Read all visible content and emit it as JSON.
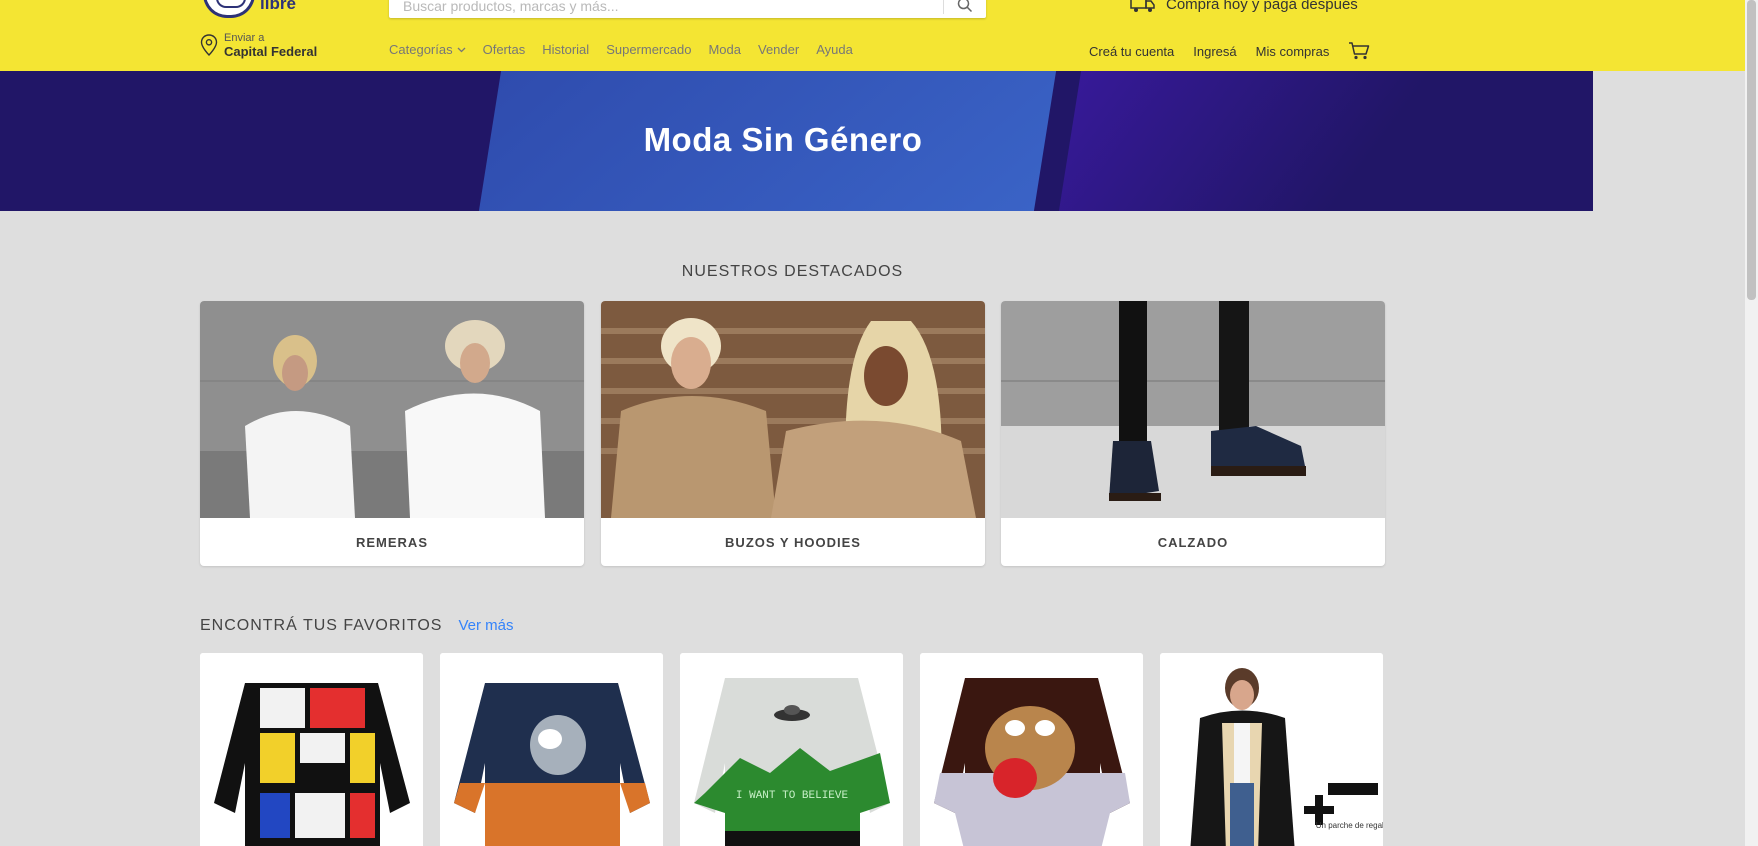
{
  "header": {
    "logo_text": "libre",
    "search": {
      "placeholder": "Buscar productos, marcas y más..."
    },
    "promo_text": "Comprá hoy y pagá después",
    "location": {
      "label": "Enviar a",
      "value": "Capital Federal"
    },
    "nav": [
      "Categorías",
      "Ofertas",
      "Historial",
      "Supermercado",
      "Moda",
      "Vender",
      "Ayuda"
    ],
    "user_nav": [
      "Creá tu cuenta",
      "Ingresá",
      "Mis compras"
    ],
    "brand_color": "#f4e533"
  },
  "hero": {
    "title": "Moda Sin Género"
  },
  "featured": {
    "title": "NUESTROS DESTACADOS",
    "cards": [
      {
        "label": "REMERAS"
      },
      {
        "label": "BUZOS Y HOODIES"
      },
      {
        "label": "CALZADO"
      }
    ]
  },
  "favorites": {
    "title": "ENCONTRÁ TUS FAVORITOS",
    "see_more": "Ver más",
    "sweater_text": "I WANT TO BELIEVE",
    "promo_text": "Un parche de regalo"
  },
  "icons": [
    "mercadolibre-logo",
    "search-icon",
    "delivery-truck-icon",
    "location-pin-icon",
    "chevron-down-icon",
    "cart-icon"
  ]
}
